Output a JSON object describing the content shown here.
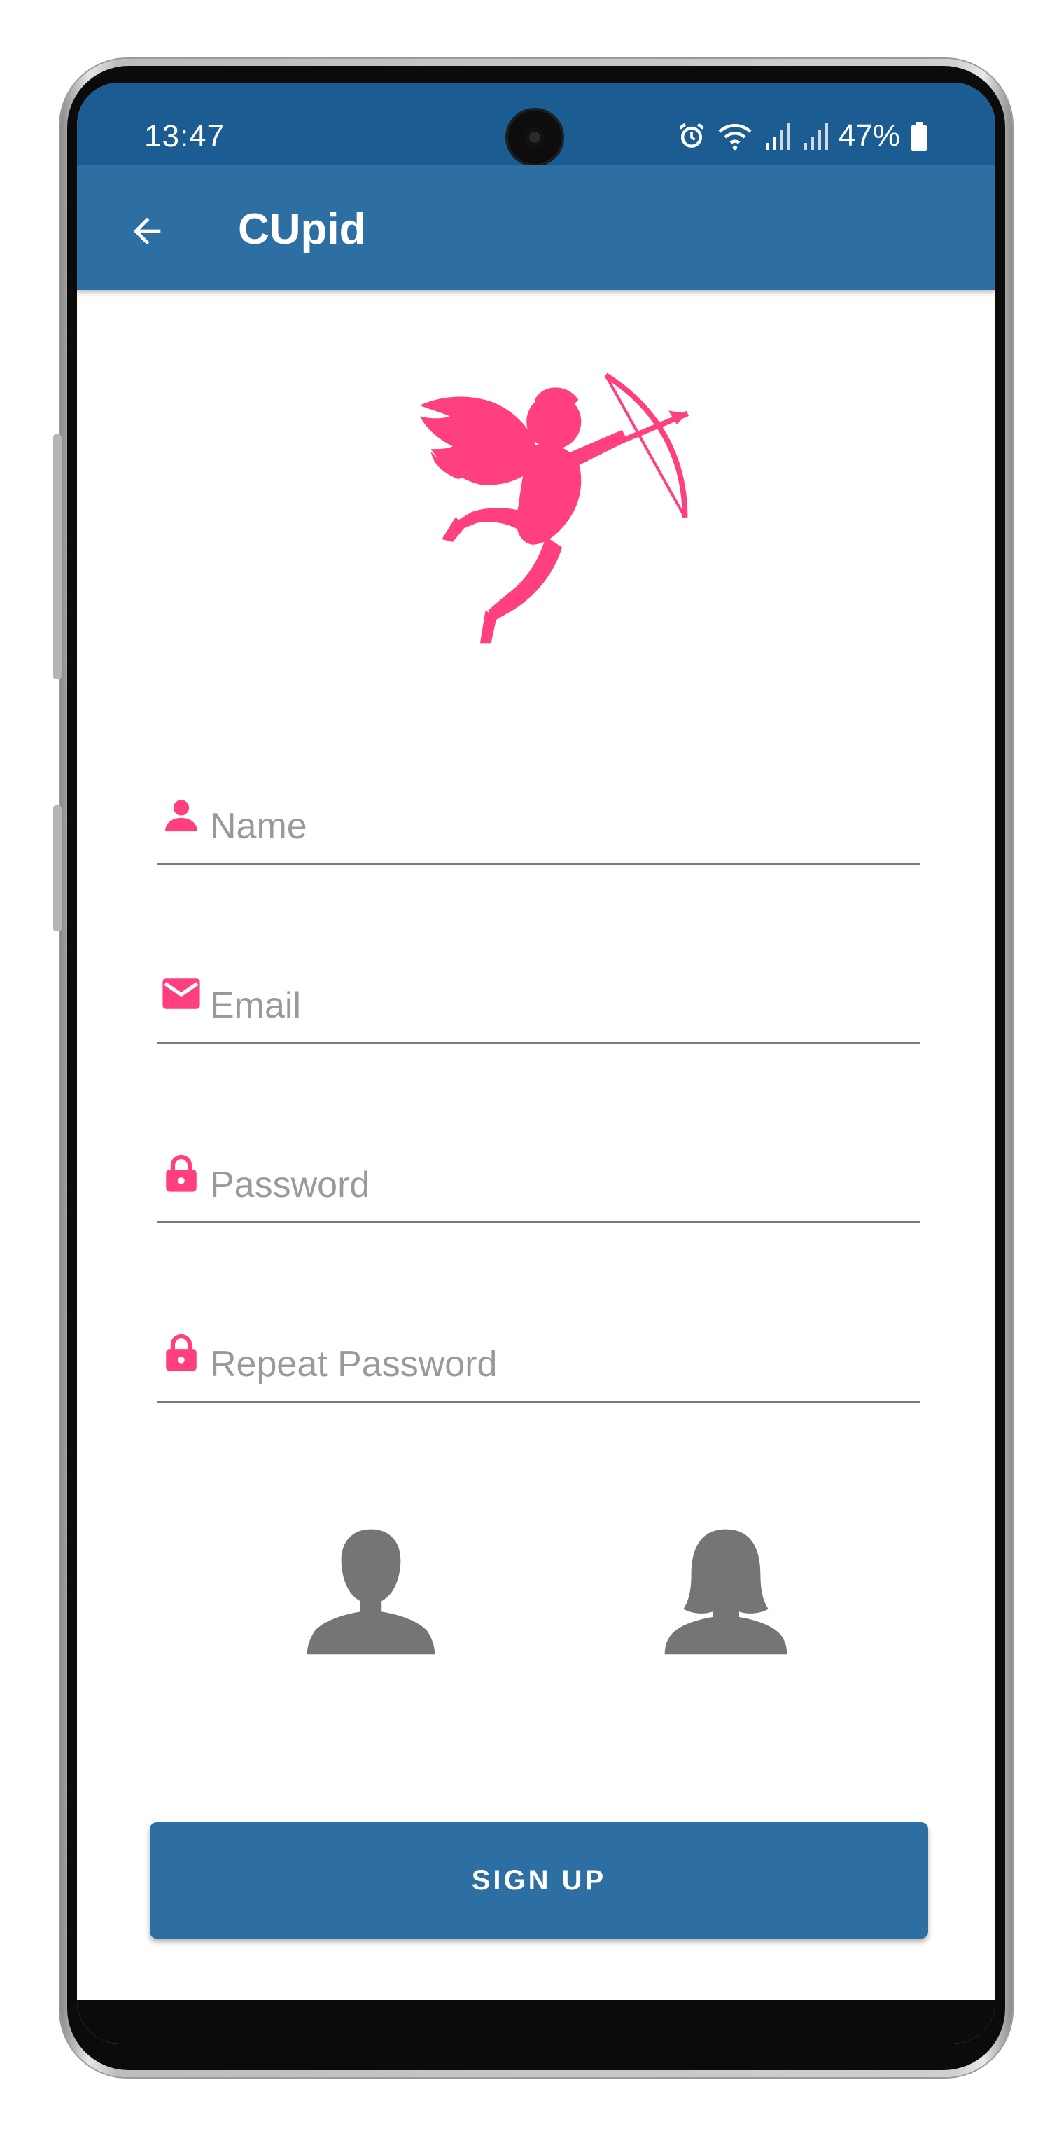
{
  "status_bar": {
    "time": "13:47",
    "battery": "47%",
    "icons": [
      "alarm-icon",
      "wifi-icon",
      "signal-icon",
      "signal-icon",
      "battery-icon"
    ]
  },
  "app_bar": {
    "title": "CUpid",
    "back_icon": "arrow-back-icon"
  },
  "logo": {
    "icon": "cupid-logo",
    "color": "#ff3f80"
  },
  "form": {
    "name": {
      "placeholder": "Name",
      "value": "",
      "icon": "person-icon"
    },
    "email": {
      "placeholder": "Email",
      "value": "",
      "icon": "mail-icon"
    },
    "password": {
      "placeholder": "Password",
      "value": "",
      "icon": "lock-icon"
    },
    "repeat_password": {
      "placeholder": "Repeat Password",
      "value": "",
      "icon": "lock-icon"
    }
  },
  "gender": {
    "options": [
      "male-avatar-icon",
      "female-avatar-icon"
    ]
  },
  "signup_button": {
    "label": "SIGN UP"
  },
  "colors": {
    "primary": "#2d6fa3",
    "status_bar": "#1b5c92",
    "accent": "#ff3f80",
    "icon_gray": "#757575"
  }
}
